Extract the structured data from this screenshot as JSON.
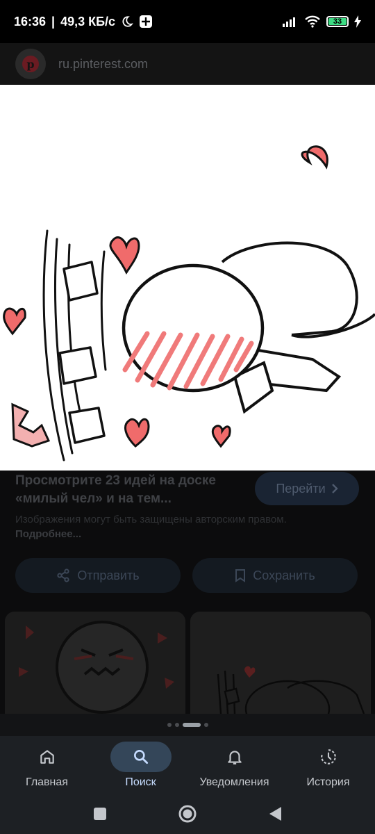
{
  "status_bar": {
    "time": "16:36",
    "speed": "49,3 КБ/с",
    "battery": "33"
  },
  "source": {
    "domain": "ru.pinterest.com",
    "logo_letter": "p",
    "logo_icon": "pinterest-logo"
  },
  "result": {
    "title": "Просмотрите 23 идей на доске «милый чел» и на тем...",
    "go_label": "Перейти",
    "disclaimer": "Изображения могут быть защищены авторским правом.",
    "more_label": "Подробнее...",
    "share_label": "Отправить",
    "save_label": "Сохранить"
  },
  "pager": {
    "count": 4,
    "active": 2
  },
  "bottom_nav": {
    "items": [
      {
        "label": "Главная",
        "icon": "home-icon"
      },
      {
        "label": "Поиск",
        "icon": "search-icon",
        "active": true
      },
      {
        "label": "Уведомления",
        "icon": "bell-icon"
      },
      {
        "label": "История",
        "icon": "history-icon"
      }
    ]
  },
  "colors": {
    "accent": "#344659",
    "heart": "#f06b6b",
    "blush": "#f07a7a"
  }
}
